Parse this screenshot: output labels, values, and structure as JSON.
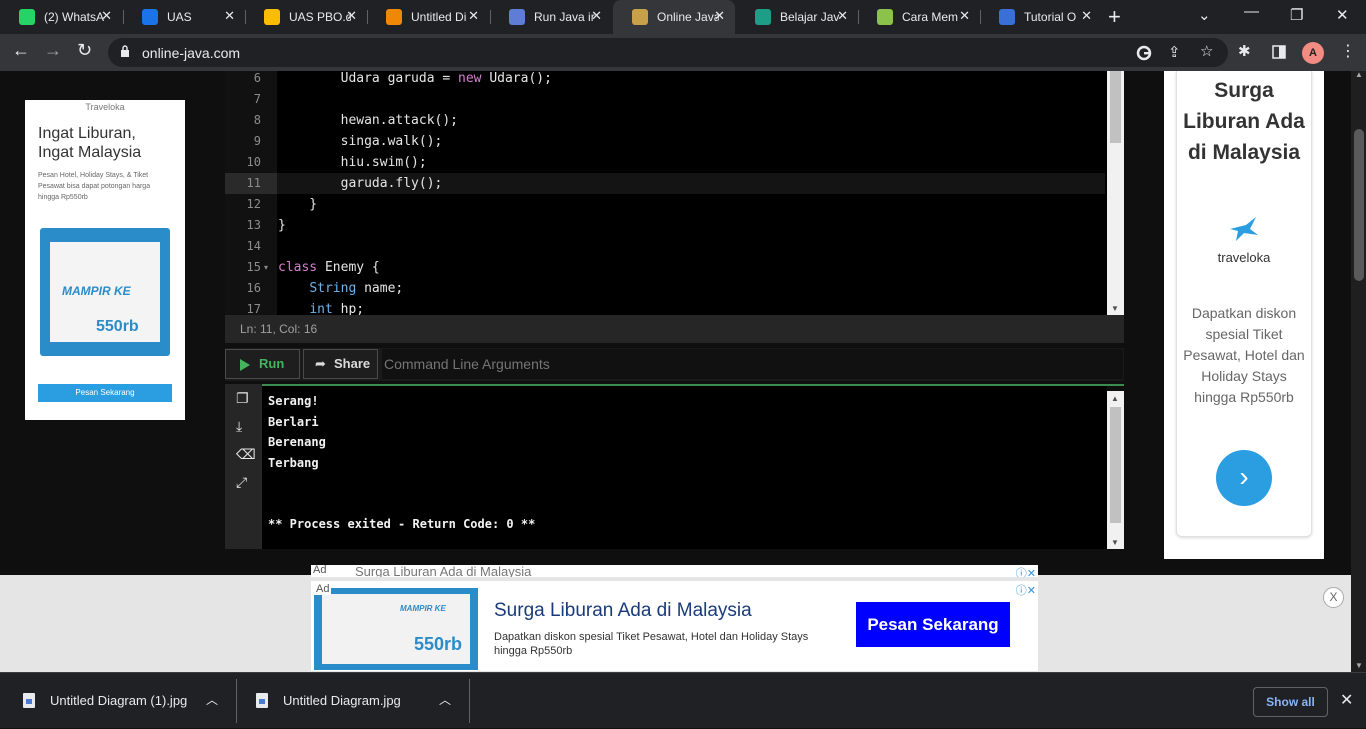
{
  "browser": {
    "tabs": [
      {
        "title": "(2) WhatsA",
        "color": "#25d366"
      },
      {
        "title": "UAS",
        "color": "#1a73e8"
      },
      {
        "title": "UAS PBO.d",
        "color": "#fbbc04"
      },
      {
        "title": "Untitled Di",
        "color": "#f08705"
      },
      {
        "title": "Run Java ir",
        "color": "#5f7cd6"
      },
      {
        "title": "Online Java",
        "color": "#c8a04a"
      },
      {
        "title": "Belajar Jav",
        "color": "#1e9e87"
      },
      {
        "title": "Cara Mem",
        "color": "#8bc34a"
      },
      {
        "title": "Tutorial O",
        "color": "#3a6fd8"
      }
    ],
    "active_tab_index": 5,
    "url": "online-java.com",
    "avatar_letter": "A"
  },
  "editor": {
    "lines": [
      {
        "n": "6",
        "code": "        Udara garuda = new Udara();"
      },
      {
        "n": "7",
        "code": ""
      },
      {
        "n": "8",
        "code": "        hewan.attack();"
      },
      {
        "n": "9",
        "code": "        singa.walk();"
      },
      {
        "n": "10",
        "code": "        hiu.swim();"
      },
      {
        "n": "11",
        "code": "        garuda.fly();"
      },
      {
        "n": "12",
        "code": "    }"
      },
      {
        "n": "13",
        "code": "}"
      },
      {
        "n": "14",
        "code": ""
      },
      {
        "n": "15",
        "code": "class Enemy {"
      },
      {
        "n": "16",
        "code": "    String name;"
      },
      {
        "n": "17",
        "code": "    int hp;"
      }
    ],
    "status": "Ln: 11,  Col: 16"
  },
  "controls": {
    "run_label": "Run",
    "share_label": "Share",
    "args_placeholder": "Command Line Arguments"
  },
  "output": {
    "lines": [
      "Serang!",
      "Berlari",
      "Berenang",
      "Terbang",
      "",
      "",
      "** Process exited - Return Code: 0 **"
    ]
  },
  "left_ad": {
    "brand": "Traveloka",
    "headline_1": "Ingat Liburan,",
    "headline_2": "Ingat Malaysia",
    "body": "Pesan Hotel, Holiday Stays, & Tiket Pesawat bisa dapat potongan harga hingga Rp550rb",
    "cta": "Pesan Sekarang"
  },
  "right_ad": {
    "headline": "Surga Liburan Ada di Malaysia",
    "logo_text": "traveloka",
    "body": "Dapatkan diskon spesial Tiket Pesawat, Hotel dan Holiday Stays hingga Rp550rb"
  },
  "banner_ad": {
    "ad_tag": "Ad",
    "ghost_title": "Surga Liburan Ada di Malaysia",
    "title": "Surga Liburan Ada di Malaysia",
    "description": "Dapatkan diskon spesial Tiket Pesawat, Hotel dan Holiday Stays hingga Rp550rb",
    "cta": "Pesan Sekarang",
    "image_line_1": "MAMPIR KE",
    "image_price": "550rb"
  },
  "downloads": {
    "items": [
      "Untitled Diagram (1).jpg",
      "Untitled Diagram.jpg"
    ],
    "show_all": "Show all"
  }
}
